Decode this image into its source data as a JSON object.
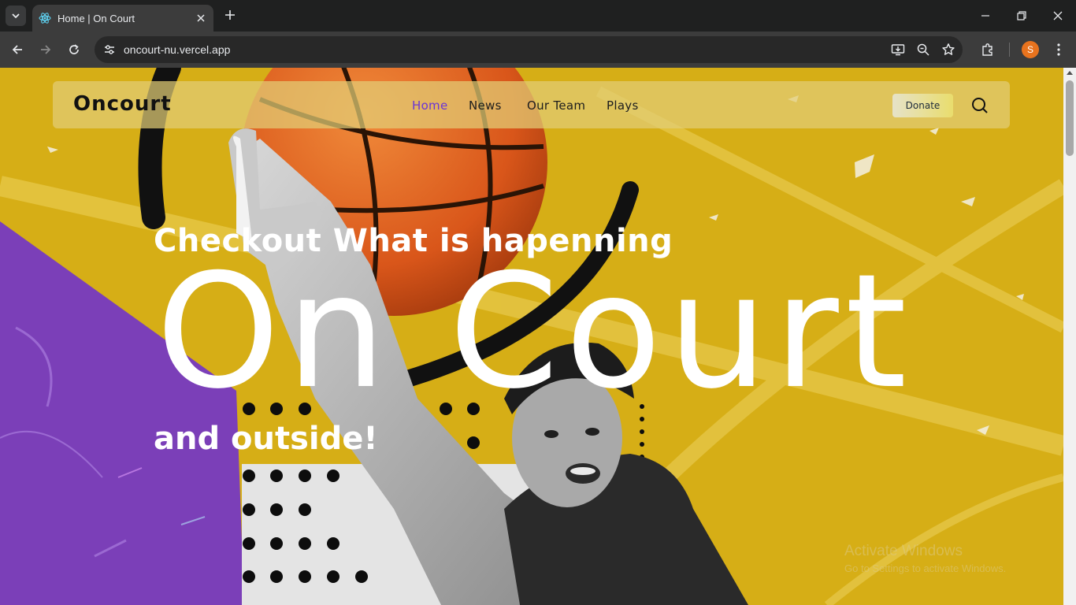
{
  "browser": {
    "tab_title": "Home | On Court",
    "url": "oncourt-nu.vercel.app",
    "profile_initial": "S"
  },
  "site": {
    "logo": "Oncourt",
    "nav": [
      {
        "label": "Home",
        "active": true
      },
      {
        "label": "News",
        "active": false
      },
      {
        "label": "Our Team",
        "active": false
      },
      {
        "label": "Plays",
        "active": false
      }
    ],
    "donate_label": "Donate"
  },
  "hero": {
    "line1": "Checkout What is hapenning",
    "big": "On Court",
    "line3": "and outside!"
  },
  "os_watermark": {
    "title": "Activate Windows",
    "subtitle": "Go to Settings to activate Windows."
  },
  "colors": {
    "accent_purple": "#6a35d6",
    "background_yellow": "#d9b21a",
    "purple_panel": "#7b3fb8",
    "ball_orange": "#e0601e"
  }
}
